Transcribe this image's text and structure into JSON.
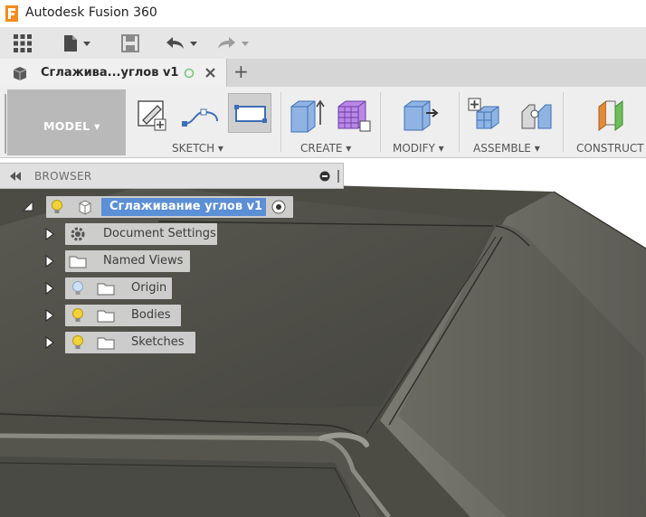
{
  "titlebar": {
    "app_title": "Autodesk Fusion 360"
  },
  "quick_access": {
    "icons": [
      "grid-icon",
      "file-icon",
      "save-icon",
      "undo-icon",
      "redo-icon"
    ]
  },
  "tab": {
    "label": "Сглажива...углов v1",
    "new_tab": "+"
  },
  "ribbon": {
    "workspace": "MODEL ▾",
    "groups": {
      "sketch": "SKETCH ▾",
      "create": "CREATE ▾",
      "modify": "MODIFY ▾",
      "assemble": "ASSEMBLE ▾",
      "construct": "CONSTRUCT"
    }
  },
  "browser": {
    "title": "BROWSER",
    "root": "Сглаживание углов v1",
    "items": [
      {
        "label": "Document Settings",
        "icon": "gear-icon"
      },
      {
        "label": "Named Views",
        "icon": "folder-icon"
      },
      {
        "label": "Origin",
        "icon": "folder-icon",
        "bulb": "light-bulb-dim"
      },
      {
        "label": "Bodies",
        "icon": "folder-icon",
        "bulb": "light-bulb-on"
      },
      {
        "label": "Sketches",
        "icon": "folder-icon",
        "bulb": "light-bulb-on"
      }
    ]
  },
  "colors": {
    "ribbon_bg": "#eeeeee",
    "workspace_bg": "#b9b9b9",
    "selection_blue": "#5b8fd6",
    "model_dark": "#4a4a43",
    "tab_active": "#f0f0f0"
  }
}
